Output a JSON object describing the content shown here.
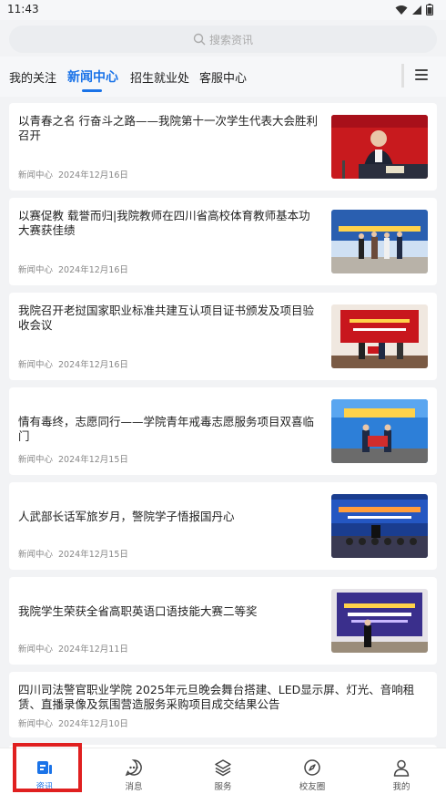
{
  "status_bar": {
    "time": "11:43"
  },
  "search": {
    "placeholder": "搜索资讯"
  },
  "tabs": [
    {
      "label": "我的关注",
      "active": false
    },
    {
      "label": "新闻中心",
      "active": true
    },
    {
      "label": "招生就业处",
      "active": false
    },
    {
      "label": "客服中心",
      "active": false
    }
  ],
  "news": [
    {
      "title": "以青春之名 行奋斗之路——我院第十一次学生代表大会胜利召开",
      "source": "新闻中心",
      "date": "2024年12月16日",
      "image": "student-congress-speaker-photo"
    },
    {
      "title": "以赛促教 载誉而归|我院教师在四川省高校体育教师基本功大赛获佳绩",
      "source": "新闻中心",
      "date": "2024年12月16日",
      "image": "teachers-award-photo"
    },
    {
      "title": "我院召开老挝国家职业标准共建互认项目证书颁发及项目验收会议",
      "source": "新闻中心",
      "date": "2024年12月16日",
      "image": "certificate-ceremony-photo"
    },
    {
      "title": "情有毒终，志愿同行——学院青年戒毒志愿服务项目双喜临门",
      "source": "新闻中心",
      "date": "2024年12月15日",
      "image": "volunteer-banner-photo"
    },
    {
      "title": "人武部长话军旅岁月，警院学子悟报国丹心",
      "source": "新闻中心",
      "date": "2024年12月15日",
      "image": "lecture-hall-photo"
    },
    {
      "title": "我院学生荣获全省高职英语口语技能大赛二等奖",
      "source": "新闻中心",
      "date": "2024年12月11日",
      "image": "english-contest-photo"
    },
    {
      "title": "四川司法警官职业学院 2025年元旦晚会舞台搭建、LED显示屏、灯光、音响租赁、直播录像及氛围营造服务采购项目成交结果公告",
      "source": "新闻中心",
      "date": "2024年12月10日",
      "image": ""
    }
  ],
  "bottom_nav": [
    {
      "label": "资讯",
      "icon": "news-icon",
      "active": true
    },
    {
      "label": "消息",
      "icon": "message-icon",
      "active": false
    },
    {
      "label": "服务",
      "icon": "layers-icon",
      "active": false
    },
    {
      "label": "校友圈",
      "icon": "compass-icon",
      "active": false
    },
    {
      "label": "我的",
      "icon": "user-icon",
      "active": false
    }
  ],
  "colors": {
    "accent": "#1a73e8",
    "highlight": "#e02020",
    "background": "#f2f3f5"
  }
}
